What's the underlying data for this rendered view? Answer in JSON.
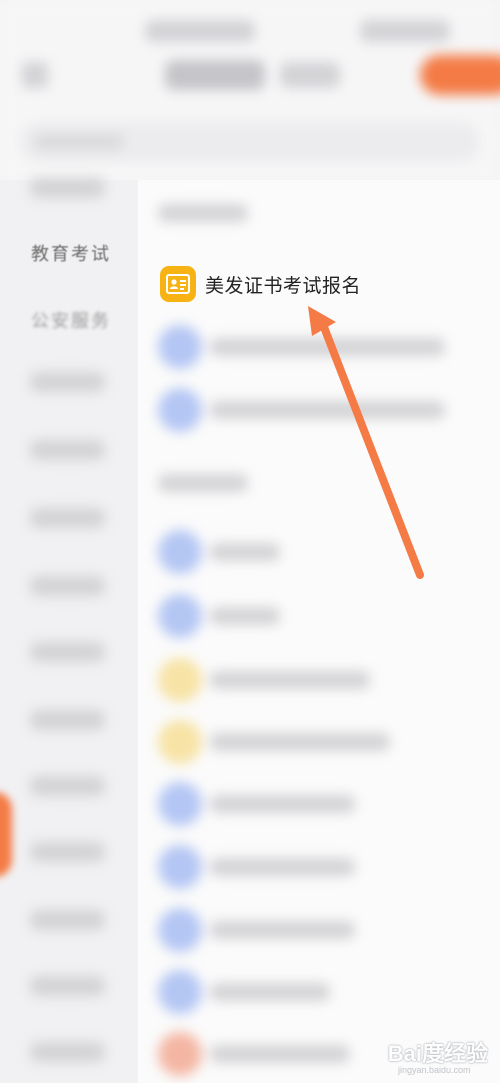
{
  "sidebar": {
    "items": [
      {
        "label": "教育考试"
      },
      {
        "label": "公安服务"
      }
    ]
  },
  "content": {
    "highlighted_item": {
      "label": "美发证书考试报名",
      "icon": "id-card-icon"
    }
  },
  "annotation": {
    "arrow_color": "#f47b45"
  },
  "watermark": {
    "text": "Bai度经验",
    "sub": "jingyan.baidu.com"
  },
  "colors": {
    "accent": "#f47b45",
    "icon_bg": "#f7b314"
  }
}
